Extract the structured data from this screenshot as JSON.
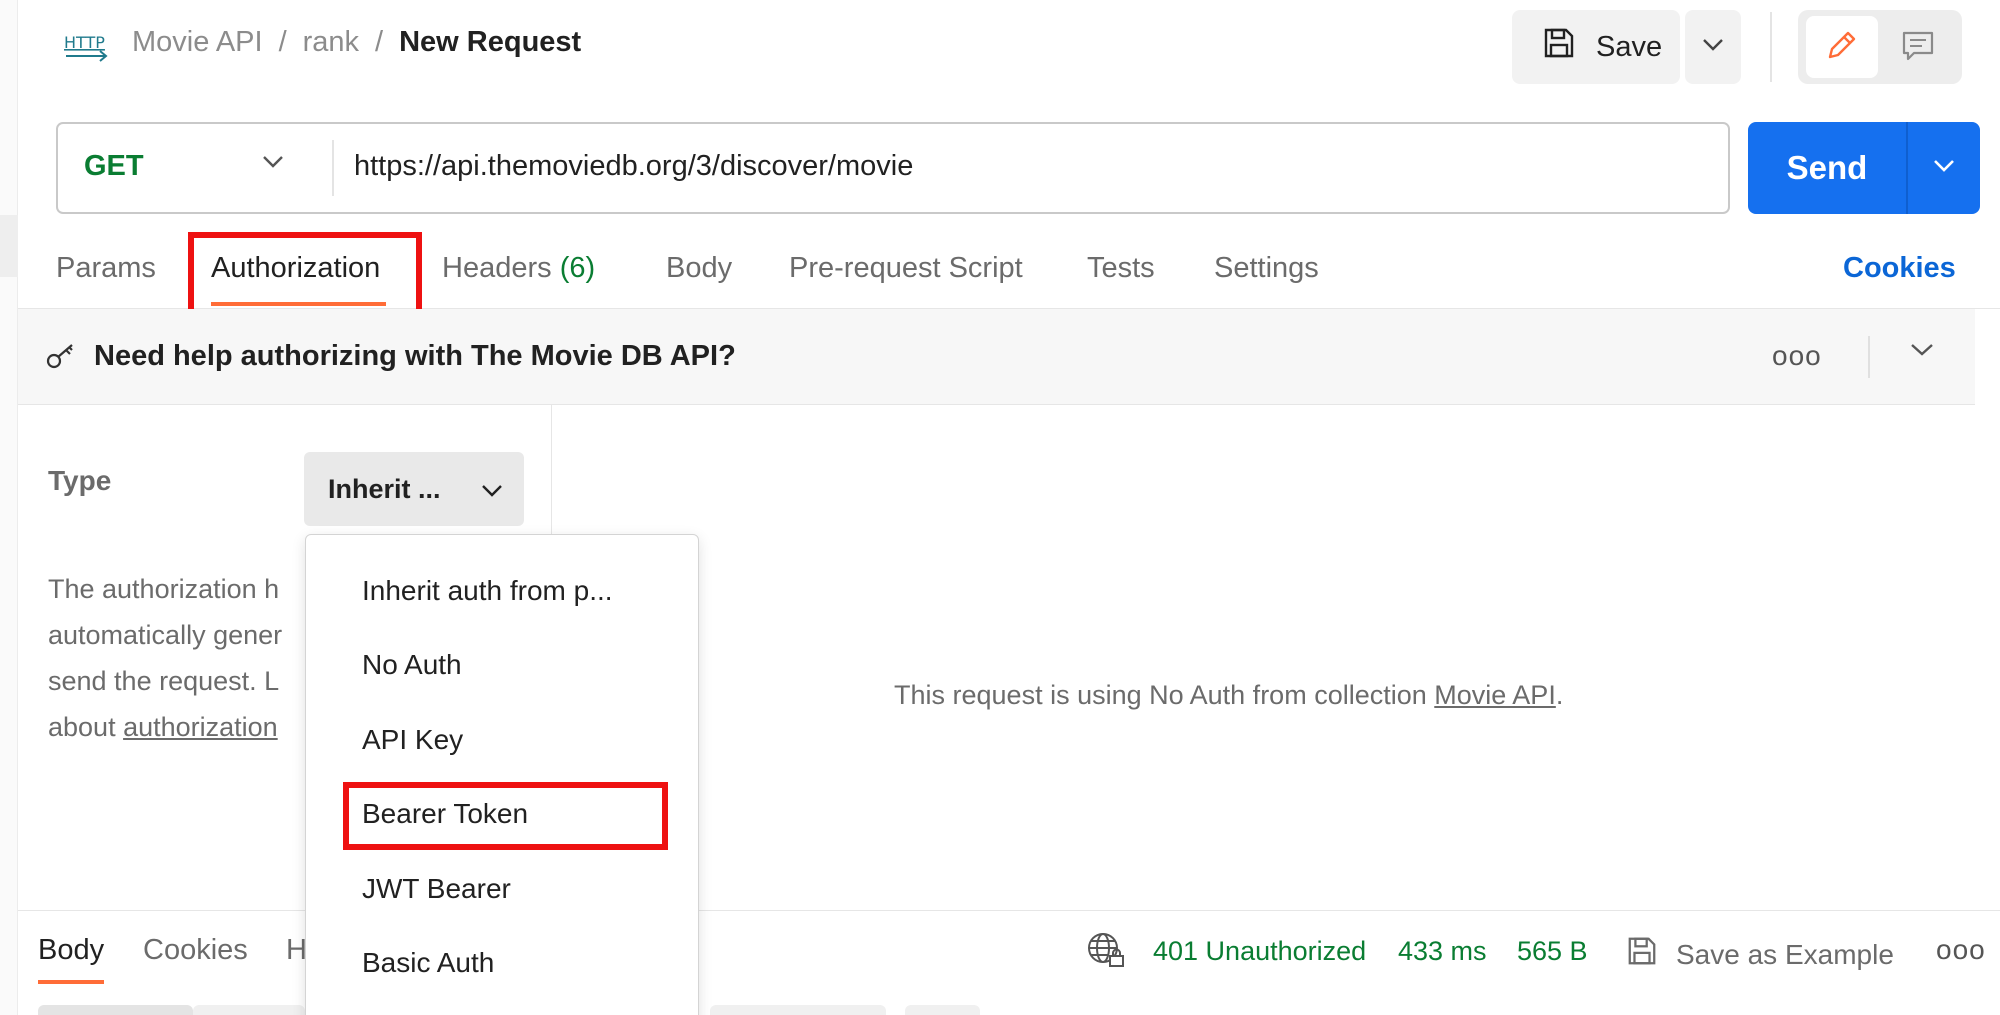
{
  "header": {
    "breadcrumb": [
      "Movie API",
      "/",
      "rank",
      "/",
      "New Request"
    ],
    "save_label": "Save"
  },
  "request": {
    "method": "GET",
    "url": "https://api.themoviedb.org/3/discover/movie",
    "send_label": "Send"
  },
  "tabs": {
    "params": "Params",
    "authorization": "Authorization",
    "headers": "Headers",
    "headers_count": "(6)",
    "body": "Body",
    "prerequest": "Pre-request Script",
    "tests": "Tests",
    "settings": "Settings",
    "cookies": "Cookies"
  },
  "help_banner": {
    "text": "Need help authorizing with The Movie DB API?",
    "more": "ooo"
  },
  "auth": {
    "type_label": "Type",
    "type_value": "Inherit ...",
    "description_lines": [
      "The authorization h",
      "automatically gener",
      "send the request. L"
    ],
    "description_prefix": "about ",
    "description_link": "authorization",
    "no_auth_prefix": "This request is using No Auth from collection ",
    "no_auth_link": "Movie API",
    "no_auth_suffix": "."
  },
  "dropdown": {
    "options": [
      "Inherit auth from p...",
      "No Auth",
      "API Key",
      "Bearer Token",
      "JWT Bearer",
      "Basic Auth"
    ],
    "highlighted": "Bearer Token"
  },
  "response": {
    "tabs": [
      "Body",
      "Cookies",
      "H"
    ],
    "status": "401 Unauthorized",
    "time": "433 ms",
    "size": "565 B",
    "save_example": "Save as Example",
    "more": "ooo"
  },
  "colors": {
    "accent_orange": "#ff6c37",
    "send_blue": "#1570ef",
    "status_green": "#0a7d32",
    "highlight_red": "#ee1111"
  }
}
